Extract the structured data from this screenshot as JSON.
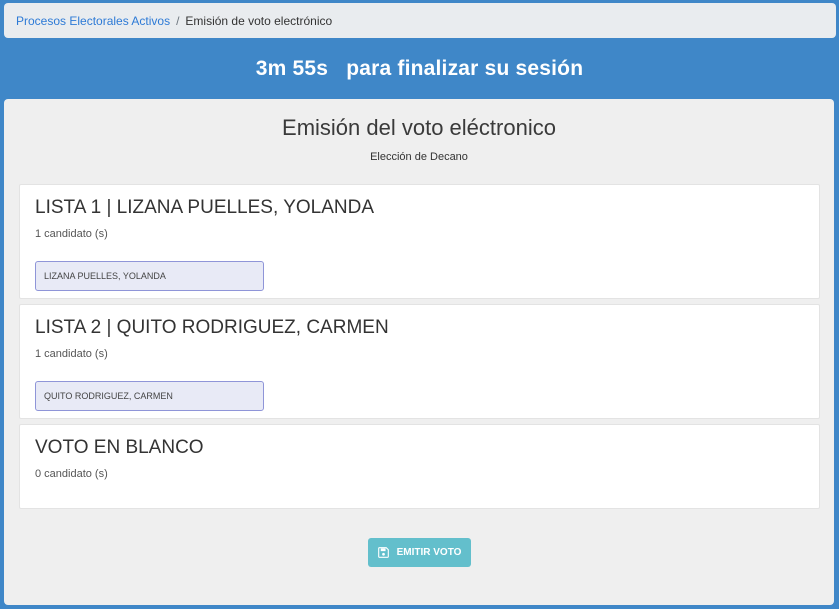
{
  "breadcrumb": {
    "link": "Procesos Electorales Activos",
    "separator": "/",
    "current": "Emisión de voto electrónico"
  },
  "timer": {
    "value": "3m 55s",
    "label": "para finalizar su sesión"
  },
  "main": {
    "title": "Emisión del voto eléctronico",
    "subtitle": "Elección de Decano"
  },
  "lists": [
    {
      "title": "LISTA 1 | LIZANA PUELLES, YOLANDA",
      "count": "1 candidato (s)",
      "candidate": "LIZANA PUELLES, YOLANDA"
    },
    {
      "title": "LISTA 2 | QUITO RODRIGUEZ, CARMEN",
      "count": "1 candidato (s)",
      "candidate": "QUITO RODRIGUEZ, CARMEN"
    },
    {
      "title": "VOTO EN BLANCO",
      "count": "0 candidato (s)"
    }
  ],
  "emit_button": {
    "label": "EMITIR VOTO",
    "icon": "save-icon"
  },
  "colors": {
    "header_blue": "#3f87c8",
    "breadcrumb_bg": "#e9ecef",
    "link_blue": "#2d7ad6",
    "card_bg": "#efefef",
    "chip_bg": "#e8eaf6",
    "chip_border": "#8f95d8",
    "button_teal": "#63bfcc"
  }
}
